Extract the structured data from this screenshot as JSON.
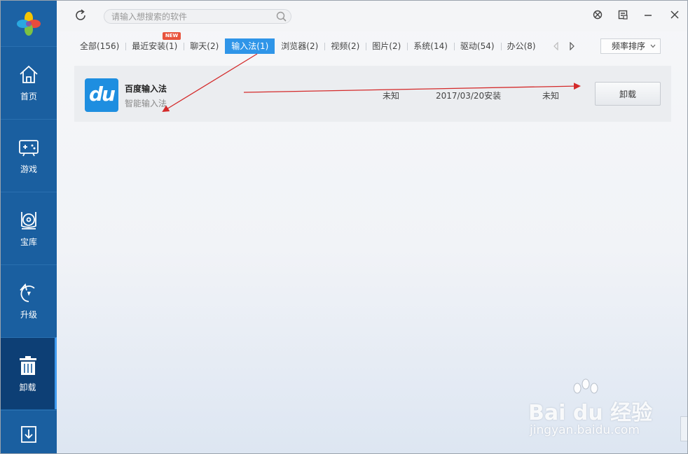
{
  "search": {
    "placeholder": "请输入想搜索的软件"
  },
  "sidebar": {
    "items": [
      {
        "label": "首页",
        "icon": "home-icon"
      },
      {
        "label": "游戏",
        "icon": "gamepad-icon"
      },
      {
        "label": "宝库",
        "icon": "disc-icon"
      },
      {
        "label": "升级",
        "icon": "upgrade-icon"
      },
      {
        "label": "卸载",
        "icon": "trash-icon",
        "active": true
      },
      {
        "label": "",
        "icon": "download-icon"
      }
    ]
  },
  "tabs": {
    "new_badge": "NEW",
    "items": [
      {
        "label": "全部(156)"
      },
      {
        "label": "最近安装(1)"
      },
      {
        "label": "聊天(2)"
      },
      {
        "label": "输入法(1)",
        "active": true
      },
      {
        "label": "浏览器(2)"
      },
      {
        "label": "视频(2)"
      },
      {
        "label": "图片(2)"
      },
      {
        "label": "系统(14)"
      },
      {
        "label": "驱动(54)"
      },
      {
        "label": "办公(8)"
      }
    ]
  },
  "sort": {
    "label": "频率排序"
  },
  "app": {
    "icon_text": "du",
    "name": "百度输入法",
    "description": "智能输入法",
    "size": "未知",
    "install_date": "2017/03/20安装",
    "frequency": "未知",
    "uninstall_label": "卸载"
  },
  "watermark": {
    "main": "Bai du 经验",
    "sub": "jingyan.baidu.com"
  },
  "colors": {
    "sidebar": "#1a5fa0",
    "sidebar_active": "#0d3f75",
    "tab_active": "#2f95e8",
    "arrow": "#d42a2a"
  }
}
